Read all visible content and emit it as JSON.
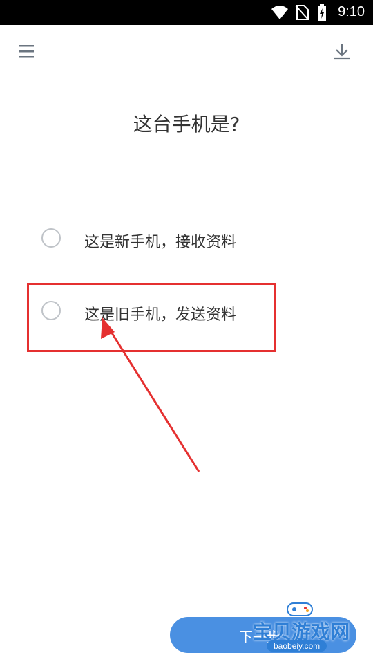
{
  "status_bar": {
    "time": "9:10",
    "icons": [
      "wifi-icon",
      "no-sim-icon",
      "battery-charging-icon"
    ]
  },
  "toolbar": {
    "menu_icon": "hamburger-menu-icon",
    "download_icon": "download-icon"
  },
  "page": {
    "title": "这台手机是?"
  },
  "options": [
    {
      "label": "这是新手机，接收资料",
      "selected": false
    },
    {
      "label": "这是旧手机，发送资料",
      "selected": false
    }
  ],
  "next_button": {
    "label": "下一步"
  },
  "watermark": {
    "text": "宝贝游戏网",
    "url": "baobeiy.com"
  },
  "colors": {
    "accent": "#4a90e2",
    "annotation": "#e53030"
  }
}
